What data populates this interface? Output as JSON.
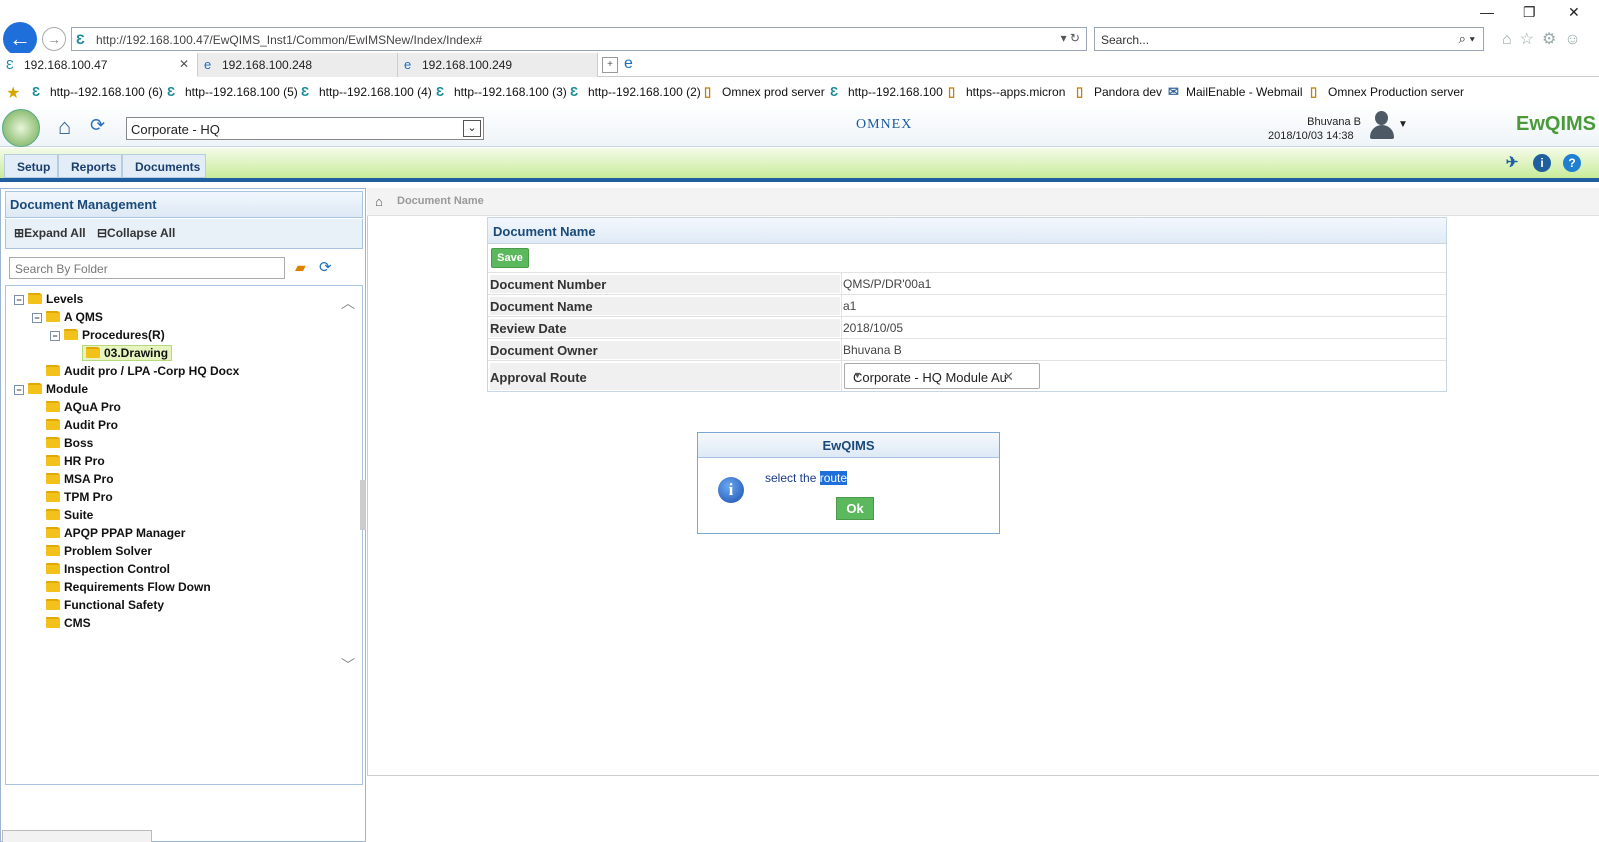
{
  "browser": {
    "url": "http://192.168.100.47/EwQIMS_Inst1/Common/EwIMSNew/Index/Index#",
    "search_placeholder": "Search...",
    "tabs": [
      {
        "label": "192.168.100.47"
      },
      {
        "label": "192.168.100.248"
      },
      {
        "label": "192.168.100.249"
      }
    ],
    "favorites": [
      {
        "label": "http--192.168.100 (6)"
      },
      {
        "label": "http--192.168.100 (5)"
      },
      {
        "label": "http--192.168.100 (4)"
      },
      {
        "label": "http--192.168.100 (3)"
      },
      {
        "label": "http--192.168.100 (2)"
      },
      {
        "label": "Omnex prod server"
      },
      {
        "label": "http--192.168.100"
      },
      {
        "label": "https--apps.micron"
      },
      {
        "label": "Pandora dev"
      },
      {
        "label": "MailEnable - Webmail"
      },
      {
        "label": "Omnex Production server"
      }
    ]
  },
  "header": {
    "site_selected": "Corporate - HQ",
    "omnex_logo": "OMNEX",
    "user_name": "Bhuvana B",
    "date_time": "2018/10/03 14:38",
    "product_logo": "EwQIMS"
  },
  "menu": {
    "items": [
      {
        "label": "Setup"
      },
      {
        "label": "Reports"
      },
      {
        "label": "Documents"
      }
    ]
  },
  "left_panel": {
    "title": "Document Management",
    "expand_all": "Expand All",
    "collapse_all": "Collapse All",
    "search_placeholder": "Search By Folder",
    "tree": [
      {
        "label": "Levels"
      },
      {
        "label": "A QMS"
      },
      {
        "label": "Procedures(R)"
      },
      {
        "label": "03.Drawing"
      },
      {
        "label": "Audit pro / LPA -Corp HQ Docx"
      },
      {
        "label": "Module"
      },
      {
        "label": "AQuA Pro"
      },
      {
        "label": "Audit Pro"
      },
      {
        "label": "Boss"
      },
      {
        "label": "HR Pro"
      },
      {
        "label": "MSA Pro"
      },
      {
        "label": "TPM Pro"
      },
      {
        "label": "Suite"
      },
      {
        "label": "APQP PPAP Manager"
      },
      {
        "label": "Problem Solver"
      },
      {
        "label": "Inspection Control"
      },
      {
        "label": "Requirements Flow Down"
      },
      {
        "label": "Functional Safety"
      },
      {
        "label": "CMS"
      }
    ]
  },
  "breadcrumb": {
    "current": "Document Name"
  },
  "form": {
    "title": "Document Name",
    "save_label": "Save",
    "rows": [
      {
        "label": "Document Number",
        "value": "QMS/P/DR'00a1"
      },
      {
        "label": "Document Name",
        "value": "a1"
      },
      {
        "label": "Review Date",
        "value": "2018/10/05"
      },
      {
        "label": "Document Owner",
        "value": "Bhuvana B"
      },
      {
        "label": "Approval Route",
        "value": "Corporate - HQ Module Au"
      }
    ]
  },
  "dialog": {
    "title": "EwQIMS",
    "message_prefix": "select the ",
    "message_highlight": "route",
    "ok_label": "Ok"
  }
}
